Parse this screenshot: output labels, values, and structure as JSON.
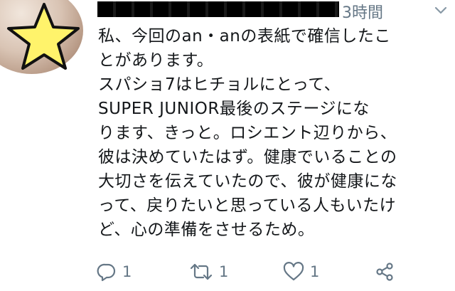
{
  "header": {
    "time": "3時間",
    "more_icon": "chevron-down-icon"
  },
  "tweet": {
    "lines": [
      "私、今回のan・anの表紙で確信したこ",
      "とがあります。",
      "スパショ7はヒチョルにとって、",
      "SUPER JUNIOR最後のステージにな",
      "ります、きっと。ロシエント辺りから、",
      "彼は決めていたはず。健康でいることの",
      "大切さを伝えていたので、彼が健康にな",
      "って、戻りたいと思っている人もいたけ",
      "ど、心の準備をさせるため。"
    ]
  },
  "actions": {
    "reply": {
      "icon": "reply-icon",
      "count": "1"
    },
    "retweet": {
      "icon": "retweet-icon",
      "count": "1"
    },
    "like": {
      "icon": "heart-icon",
      "count": "1"
    },
    "share": {
      "icon": "share-icon"
    }
  },
  "colors": {
    "text": "#14171a",
    "muted": "#657786",
    "star_fill": "#fff36b",
    "star_stroke": "#111111"
  }
}
